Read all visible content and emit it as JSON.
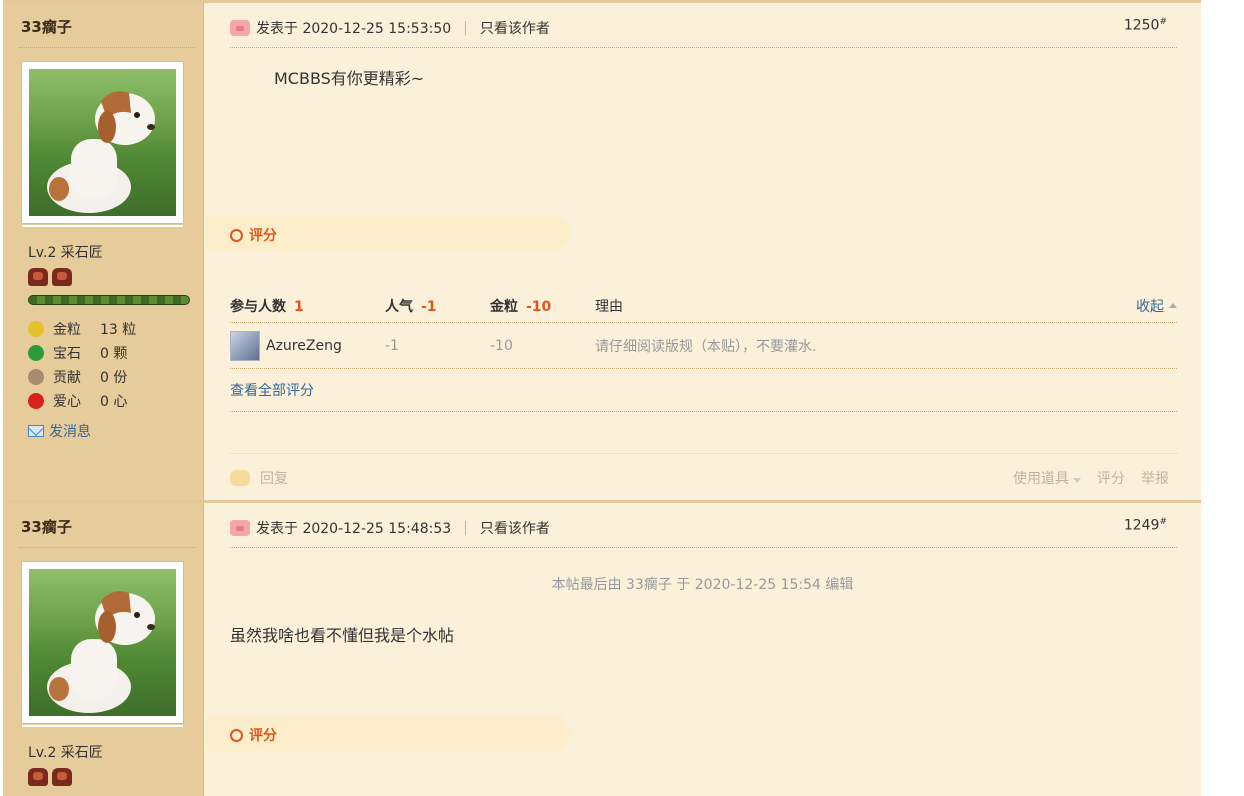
{
  "posts": [
    {
      "author": "33瘸子",
      "level": "Lv.2 采石匠",
      "stats": [
        {
          "label": "金粒",
          "value": "13 粒",
          "icon": "gold-nugget-icon",
          "color": "#e6c22a"
        },
        {
          "label": "宝石",
          "value": "0 颗",
          "icon": "emerald-icon",
          "color": "#2f9a3a"
        },
        {
          "label": "贡献",
          "value": "0 份",
          "icon": "contribution-icon",
          "color": "#a88a6e"
        },
        {
          "label": "爱心",
          "value": "0 心",
          "icon": "apple-heart-icon",
          "color": "#d8211c"
        }
      ],
      "message_link": "发消息",
      "posted_at": "发表于 2020-12-25 15:53:50",
      "only_author": "只看该作者",
      "floor": "1250",
      "floor_mark": "#",
      "content": "MCBBS有你更精彩~",
      "rate_label": "评分",
      "rating": {
        "participants_label": "参与人数",
        "participants": "1",
        "popularity_label": "人气",
        "popularity": "-1",
        "gold_label": "金粒",
        "gold": "-10",
        "reason_label": "理由",
        "collapse_label": "收起",
        "rows": [
          {
            "user": "AzureZeng",
            "popularity": "-1",
            "gold": "-10",
            "reason": "请仔细阅读版规（本贴），不要灌水."
          }
        ],
        "view_all": "查看全部评分"
      },
      "footer": {
        "reply": "回复",
        "use_item": "使用道具",
        "rate": "评分",
        "report": "举报"
      }
    },
    {
      "author": "33瘸子",
      "level": "Lv.2 采石匠",
      "posted_at": "发表于 2020-12-25 15:48:53",
      "only_author": "只看该作者",
      "floor": "1249",
      "floor_mark": "#",
      "edit_note": "本帖最后由 33瘸子 于 2020-12-25 15:54 编辑",
      "content": "虽然我啥也看不懂但我是个水帖",
      "rate_label": "评分"
    }
  ],
  "colors": {
    "sidebar": "#e6cc9b",
    "main": "#fbf1da",
    "accent": "#e1571a",
    "link": "#336699"
  }
}
